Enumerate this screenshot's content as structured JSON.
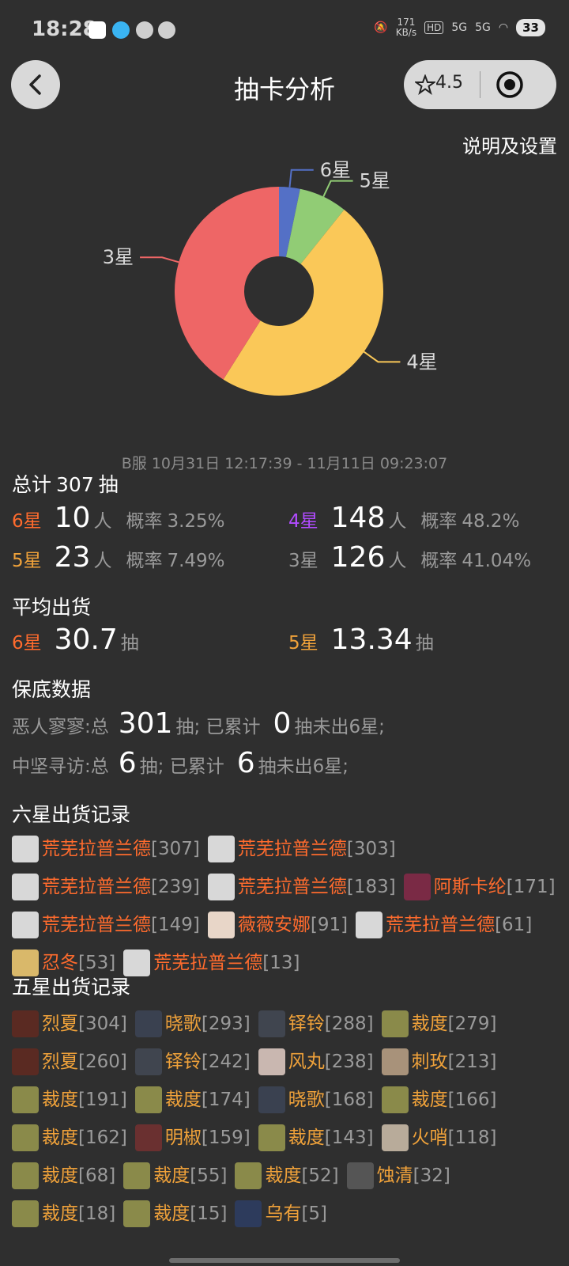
{
  "status": {
    "time": "18:28",
    "net_speed": "171",
    "net_unit": "KB/s",
    "signal1": "5G",
    "signal2": "5G",
    "battery": "33"
  },
  "nav": {
    "title": "抽卡分析",
    "rating": "4.5"
  },
  "settings_label": "说明及设置",
  "chart_data": {
    "type": "pie",
    "labels": [
      "6星",
      "5星",
      "4星",
      "3星"
    ],
    "values": [
      10,
      23,
      148,
      126
    ],
    "colors": [
      "#5470c6",
      "#91cc75",
      "#fac858",
      "#ee6666"
    ]
  },
  "date_range": "B服  10月31日 12:17:39  -  11月11日 09:23:07",
  "total": {
    "prefix": "总计",
    "count": "307",
    "suffix": "抽"
  },
  "stats": [
    {
      "star": "6星",
      "count": "10",
      "unit": "人",
      "prob_label": "概率",
      "prob": "3.25%"
    },
    {
      "star": "4星",
      "count": "148",
      "unit": "人",
      "prob_label": "概率",
      "prob": "48.2%"
    },
    {
      "star": "5星",
      "count": "23",
      "unit": "人",
      "prob_label": "概率",
      "prob": "7.49%"
    },
    {
      "star": "3星",
      "count": "126",
      "unit": "人",
      "prob_label": "概率",
      "prob": "41.04%"
    }
  ],
  "avg_title": "平均出货",
  "avg": [
    {
      "star": "6星",
      "value": "30.7",
      "unit": "抽"
    },
    {
      "star": "5星",
      "value": "13.34",
      "unit": "抽"
    }
  ],
  "pity_title": "保底数据",
  "pity": [
    {
      "pool": "恶人寥寥:总",
      "total": "301",
      "mid": "抽; 已累计",
      "current": "0",
      "end": "抽未出6星;"
    },
    {
      "pool": "中坚寻访:总",
      "total": "6",
      "mid": "抽; 已累计",
      "current": "6",
      "end": "抽未出6星;"
    }
  ],
  "six_title": "六星出货记录",
  "six_records": [
    {
      "name": "荒芜拉普兰德",
      "pull": "[307]",
      "avatar": "#d8d8d8"
    },
    {
      "name": "荒芜拉普兰德",
      "pull": "[303]",
      "avatar": "#d8d8d8"
    },
    {
      "name": "荒芜拉普兰德",
      "pull": "[239]",
      "avatar": "#d8d8d8"
    },
    {
      "name": "荒芜拉普兰德",
      "pull": "[183]",
      "avatar": "#d8d8d8"
    },
    {
      "name": "阿斯卡纶",
      "pull": "[171]",
      "avatar": "#7a2a45"
    },
    {
      "name": "荒芜拉普兰德",
      "pull": "[149]",
      "avatar": "#d8d8d8"
    },
    {
      "name": "薇薇安娜",
      "pull": "[91]",
      "avatar": "#e8d6c8"
    },
    {
      "name": "荒芜拉普兰德",
      "pull": "[61]",
      "avatar": "#d8d8d8"
    },
    {
      "name": "忍冬",
      "pull": "[53]",
      "avatar": "#d9b86a"
    },
    {
      "name": "荒芜拉普兰德",
      "pull": "[13]",
      "avatar": "#d8d8d8"
    }
  ],
  "five_title": "五星出货记录",
  "five_records": [
    {
      "name": "烈夏",
      "pull": "[304]",
      "avatar": "#5a2a22"
    },
    {
      "name": "晓歌",
      "pull": "[293]",
      "avatar": "#3a4150"
    },
    {
      "name": "铎铃",
      "pull": "[288]",
      "avatar": "#40454f"
    },
    {
      "name": "裁度",
      "pull": "[279]",
      "avatar": "#8a8a4a"
    },
    {
      "name": "烈夏",
      "pull": "[260]",
      "avatar": "#5a2a22"
    },
    {
      "name": "铎铃",
      "pull": "[242]",
      "avatar": "#40454f"
    },
    {
      "name": "风丸",
      "pull": "[238]",
      "avatar": "#c9b7b0"
    },
    {
      "name": "刺玫",
      "pull": "[213]",
      "avatar": "#a8927a"
    },
    {
      "name": "裁度",
      "pull": "[191]",
      "avatar": "#8a8a4a"
    },
    {
      "name": "裁度",
      "pull": "[174]",
      "avatar": "#8a8a4a"
    },
    {
      "name": "晓歌",
      "pull": "[168]",
      "avatar": "#3a4150"
    },
    {
      "name": "裁度",
      "pull": "[166]",
      "avatar": "#8a8a4a"
    },
    {
      "name": "裁度",
      "pull": "[162]",
      "avatar": "#8a8a4a"
    },
    {
      "name": "明椒",
      "pull": "[159]",
      "avatar": "#6a3030"
    },
    {
      "name": "裁度",
      "pull": "[143]",
      "avatar": "#8a8a4a"
    },
    {
      "name": "火哨",
      "pull": "[118]",
      "avatar": "#b8ab9a"
    },
    {
      "name": "裁度",
      "pull": "[68]",
      "avatar": "#8a8a4a"
    },
    {
      "name": "裁度",
      "pull": "[55]",
      "avatar": "#8a8a4a"
    },
    {
      "name": "裁度",
      "pull": "[52]",
      "avatar": "#8a8a4a"
    },
    {
      "name": "蚀清",
      "pull": "[32]",
      "avatar": "#555555"
    },
    {
      "name": "裁度",
      "pull": "[18]",
      "avatar": "#8a8a4a"
    },
    {
      "name": "裁度",
      "pull": "[15]",
      "avatar": "#8a8a4a"
    },
    {
      "name": "乌有",
      "pull": "[5]",
      "avatar": "#2d3b5c"
    }
  ]
}
